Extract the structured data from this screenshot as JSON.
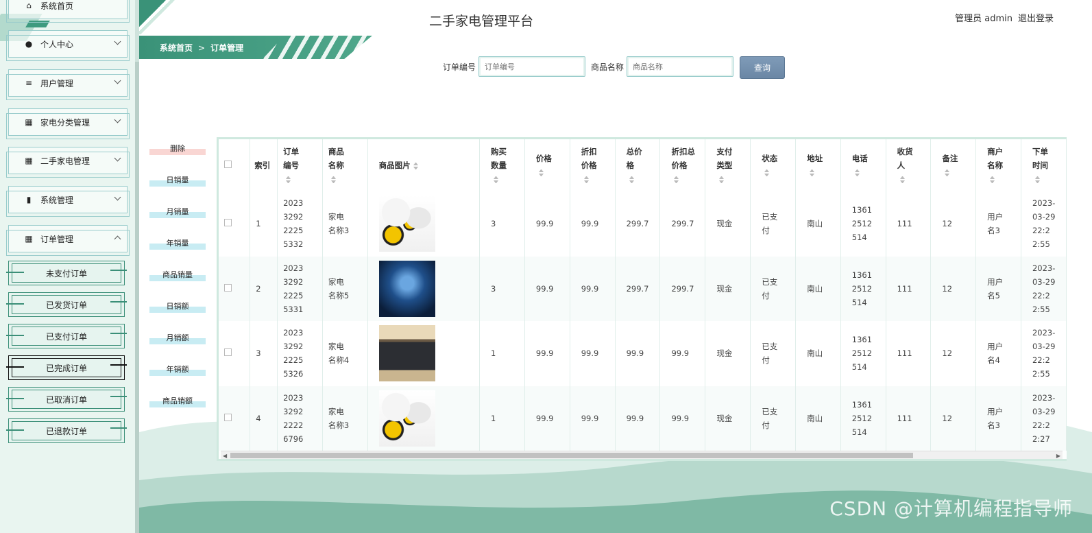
{
  "app": {
    "title": "二手家电管理平台",
    "user_label": "管理员 admin",
    "logout": "退出登录"
  },
  "sidebar": {
    "items": [
      {
        "label": "系统首页",
        "icon": "home-icon"
      },
      {
        "label": "个人中心",
        "icon": "person-icon"
      },
      {
        "label": "用户管理",
        "icon": "sliders-icon"
      },
      {
        "label": "家电分类管理",
        "icon": "grid-icon"
      },
      {
        "label": "二手家电管理",
        "icon": "grid-icon"
      },
      {
        "label": "系统管理",
        "icon": "bar-chart-icon"
      },
      {
        "label": "订单管理",
        "icon": "grid-icon"
      }
    ],
    "subitems": [
      "未支付订单",
      "已发货订单",
      "已支付订单",
      "已完成订单",
      "已取消订单",
      "已退款订单"
    ]
  },
  "breadcrumb": {
    "home": "系统首页",
    "sep": ">",
    "current": "订单管理"
  },
  "search": {
    "order_label": "订单编号",
    "order_placeholder": "订单编号",
    "name_label": "商品名称",
    "name_placeholder": "商品名称",
    "query_button": "查询"
  },
  "actions": [
    "删除",
    "日销量",
    "月销量",
    "年销量",
    "商品销量",
    "日销额",
    "月销额",
    "年销额",
    "商品销额"
  ],
  "table": {
    "headers": {
      "index": "索引",
      "order_no": "订单编号",
      "name": "商品名称",
      "image": "商品图片",
      "qty": "购买数量",
      "price": "价格",
      "disc_price": "折扣价格",
      "total": "总价格",
      "disc_total": "折扣总价格",
      "pay_type": "支付类型",
      "status": "状态",
      "address": "地址",
      "phone": "电话",
      "receiver": "收货人",
      "note": "备注",
      "merchant": "商户名称",
      "time": "下单时间"
    },
    "rows": [
      {
        "index": "1",
        "order_no": "20233292 22255332",
        "name": "家电名称3",
        "image": "img1",
        "qty": "3",
        "price": "99.9",
        "disc_price": "99.9",
        "total": "299.7",
        "disc_total": "299.7",
        "pay_type": "现金",
        "status": "已支付",
        "address": "南山",
        "phone": "13612512514",
        "receiver": "111",
        "note": "12",
        "merchant": "用户名3",
        "time": "2023-03-29 22:22:55"
      },
      {
        "index": "2",
        "order_no": "20233292 22255331",
        "name": "家电名称5",
        "image": "img2",
        "qty": "3",
        "price": "99.9",
        "disc_price": "99.9",
        "total": "299.7",
        "disc_total": "299.7",
        "pay_type": "现金",
        "status": "已支付",
        "address": "南山",
        "phone": "13612512514",
        "receiver": "111",
        "note": "12",
        "merchant": "用户名5",
        "time": "2023-03-29 22:22:55"
      },
      {
        "index": "3",
        "order_no": "20233292 22255326",
        "name": "家电名称4",
        "image": "img3",
        "qty": "1",
        "price": "99.9",
        "disc_price": "99.9",
        "total": "99.9",
        "disc_total": "99.9",
        "pay_type": "现金",
        "status": "已支付",
        "address": "南山",
        "phone": "13612512514",
        "receiver": "111",
        "note": "12",
        "merchant": "用户名4",
        "time": "2023-03-29 22:22:55"
      },
      {
        "index": "4",
        "order_no": "20233292 22226796",
        "name": "家电名称3",
        "image": "img1",
        "qty": "1",
        "price": "99.9",
        "disc_price": "99.9",
        "total": "99.9",
        "disc_total": "99.9",
        "pay_type": "现金",
        "status": "已支付",
        "address": "南山",
        "phone": "13612512514",
        "receiver": "111",
        "note": "12",
        "merchant": "用户名3",
        "time": "2023-03-29 22:22:27"
      }
    ]
  },
  "watermark": "CSDN @计算机编程指导师",
  "colors": {
    "accent": "#3a9278",
    "query_button": "#6b87a5"
  }
}
